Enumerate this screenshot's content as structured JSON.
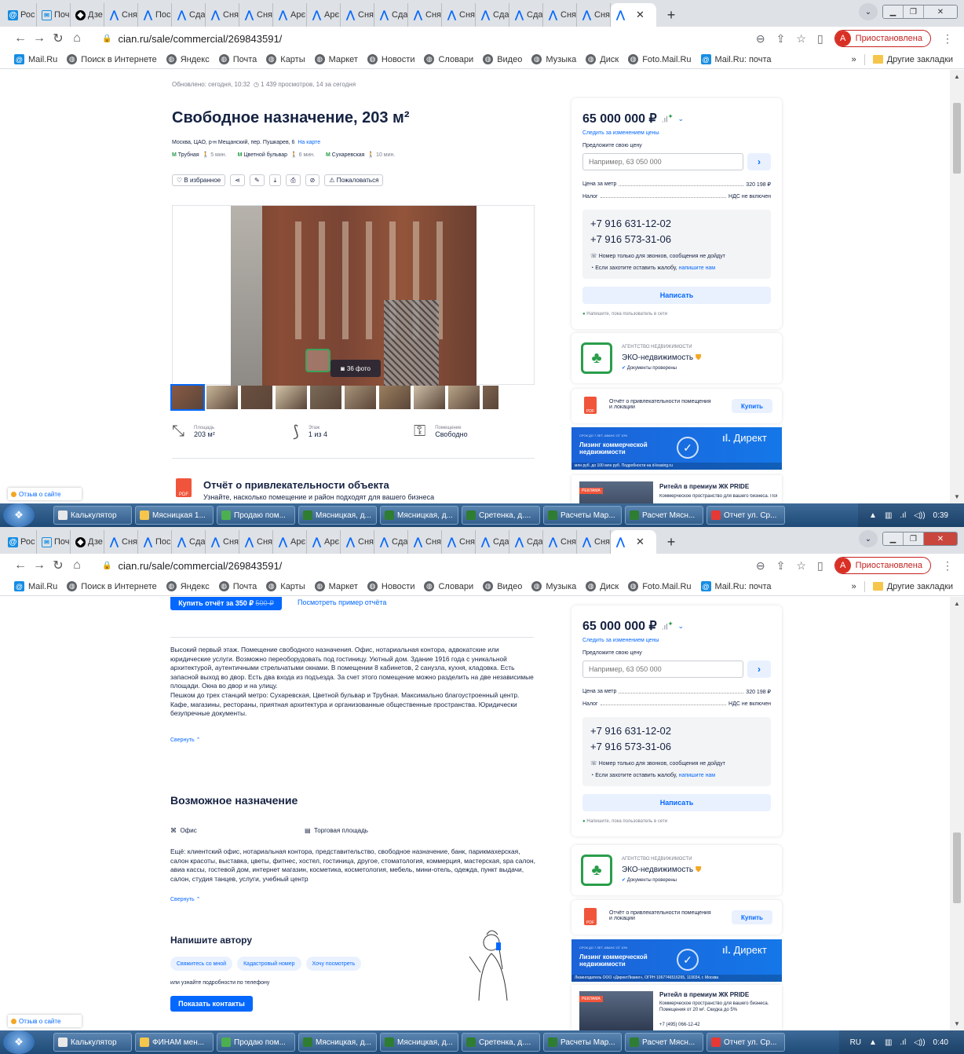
{
  "browser": {
    "tabs": [
      {
        "label": "Рос",
        "icon": "mail"
      },
      {
        "label": "Поч",
        "icon": "env"
      },
      {
        "label": "Дзе",
        "icon": "dz"
      },
      {
        "label": "Сня",
        "icon": "cian"
      },
      {
        "label": "Пос",
        "icon": "cian"
      },
      {
        "label": "Сда",
        "icon": "cian"
      },
      {
        "label": "Сня",
        "icon": "cian"
      },
      {
        "label": "Сня",
        "icon": "cian"
      },
      {
        "label": "Арє",
        "icon": "cian"
      },
      {
        "label": "Арє",
        "icon": "cian"
      },
      {
        "label": "Сня",
        "icon": "cian"
      },
      {
        "label": "Сда",
        "icon": "cian"
      },
      {
        "label": "Сня",
        "icon": "cian"
      },
      {
        "label": "Сня",
        "icon": "cian"
      },
      {
        "label": "Сда",
        "icon": "cian"
      },
      {
        "label": "Сда",
        "icon": "cian"
      },
      {
        "label": "Сня",
        "icon": "cian"
      },
      {
        "label": "Сня",
        "icon": "cian"
      }
    ],
    "url": "cian.ru/sale/commercial/269843591/",
    "paused_label": "Приостановлена",
    "avatar_letter": "A",
    "bookmarks": [
      "Mail.Ru",
      "Поиск в Интернете",
      "Яндекс",
      "Почта",
      "Карты",
      "Маркет",
      "Новости",
      "Словари",
      "Видео",
      "Музыка",
      "Диск",
      "Foto.Mail.Ru",
      "Mail.Ru: почта"
    ],
    "more_bookmarks": "»",
    "other_bookmarks": "Другие закладки"
  },
  "listing": {
    "updated": "Обновлено: сегодня, 10:32",
    "views": "1 439 просмотров, 14 за сегодня",
    "title": "Свободное назначение, 203 м²",
    "address": "Москва, ЦАО, р-н Мещанский, пер. Пушкарев, 6",
    "map_link": "На карте",
    "metro": [
      {
        "name": "Трубная",
        "time": "5 мин."
      },
      {
        "name": "Цветной бульвар",
        "time": "6 мин."
      },
      {
        "name": "Сухаревская",
        "time": "10 мин."
      }
    ],
    "fav_label": "В избранное",
    "complain_label": "Пожаловаться",
    "photo_count": "36 фото",
    "facts": [
      {
        "label": "Площадь",
        "value": "203 м²"
      },
      {
        "label": "Этаж",
        "value": "1 из 4"
      },
      {
        "label": "Помещение",
        "value": "Свободно"
      }
    ],
    "report_title": "Отчёт о привлекательности объекта",
    "report_sub": "Узнайте, насколько помещение и район подходят для вашего бизнеса",
    "buy_report": "Купить отчёт за 350 ₽",
    "buy_report_old": "500 ₽",
    "example_report": "Посмотреть пример отчёта",
    "description": "Высокий первый этаж. Помещение свободного назначения. Офис, нотариальная контора, адвокатские или юридические услуги. Возможно переоборудовать под гостиницу. Уютный дом. Здание 1916 года с уникальной архитектурой, аутентичными стрельчатыми окнами. В помещении 8 кабинетов, 2 санузла, кухня, кладовка. Есть запасной выход во двор. Есть два входа из подъезда. За счет этого помещение можно разделить на две независимые площади. Окна во двор и на улицу.\nПешком до трех станций метро: Сухаревская, Цветной бульвар и Трубная. Максимально благоустроенный центр. Кафе, магазины, рестораны, приятная архитектура и организованные общественные пространства. Юридически безупречные документы.",
    "collapse": "Свернуть",
    "purpose_title": "Возможное назначение",
    "purposes": [
      "Офис",
      "Торговая площадь"
    ],
    "purpose_more": "Ещё: клиентский офис, нотариальная контора, представительство, свободное назначение, банк, парикмахерская, салон красоты, выставка, цветы, фитнес, хостел, гостиница, другое, стоматология, коммерция, мастерская, spa салон, авиа кассы, гостевой дом, интернет магазин, косметика, косметология, мебель, мини-отель, одежда, пункт выдачи, салон, студия танцев, услуги, учебный центр",
    "write_title": "Напишите автору",
    "write_chips": [
      "Свяжитесь со мной",
      "Кадастровый номер",
      "Хочу посмотреть"
    ],
    "write_or": "или узнайте подробности по телефону",
    "show_contacts": "Показать контакты"
  },
  "sidebar": {
    "price": "65 000 000 ₽",
    "watch_price": "Следить за изменением цены",
    "offer_label": "Предложите свою цену",
    "offer_placeholder": "Например, 63 050 000",
    "per_meter_label": "Цена за метр",
    "per_meter_value": "320 198 ₽",
    "tax_label": "Налог",
    "tax_value": "НДС не включен",
    "phones": [
      "+7 916 631-12-02",
      "+7 916 573-31-06"
    ],
    "calls_only": "Номер только для звонков, сообщения не дойдут",
    "complain_text": "Если захотите оставить жалобу,",
    "complain_link": "напишите нам",
    "write_btn": "Написать",
    "online": "Напишите, пока пользователь в сети",
    "agency_type": "АГЕНТСТВО НЕДВИЖИМОСТИ",
    "agency_name": "ЭКО-недвижимость",
    "docs_checked": "Документы проверены",
    "report_title": "Отчёт о привлекательности помещения и локации",
    "buy": "Купить",
    "ad_small": "СРОК ДО 7 ЛЕТ, АВАНС ОТ 10%",
    "ad_title": "Лизинг коммерческой недвижимости",
    "ad_brand": "Директ",
    "ad_foot1": "млн руб. до 100 млн руб. Подробности на d-leasing.ru",
    "ad_foot2": "Лизингодатель ООО «ДиректЛизинг», ОГРН 1067746516265, 119034, г. Москва",
    "pride_badge": "РЕКЛАМА",
    "pride_title": "Ритейл в премиум ЖК PRIDE",
    "pride_text": "Коммерческое пространство для вашего бизнеса. Помещения от 20 м². Скидка до 5%",
    "pride_phone": "+7 (495) 066-12-42"
  },
  "feedback": "Отзыв о сайте",
  "taskbar1": {
    "items": [
      "Калькулятор",
      "Мясницкая 1...",
      "Продаю пом...",
      "Мясницкая, д...",
      "Мясницкая, д...",
      "Сретенка, д....",
      "Расчеты Мар...",
      "Расчет Мясн...",
      "Отчет ул. Ср..."
    ],
    "time": "0:39"
  },
  "taskbar2": {
    "items": [
      "Калькулятор",
      "ФИНАМ мен...",
      "Продаю пом...",
      "Мясницкая, д...",
      "Мясницкая, д...",
      "Сретенка, д....",
      "Расчеты Мар...",
      "Расчет Мясн...",
      "Отчет ул. Ср..."
    ],
    "lang": "RU",
    "time": "0:40"
  }
}
